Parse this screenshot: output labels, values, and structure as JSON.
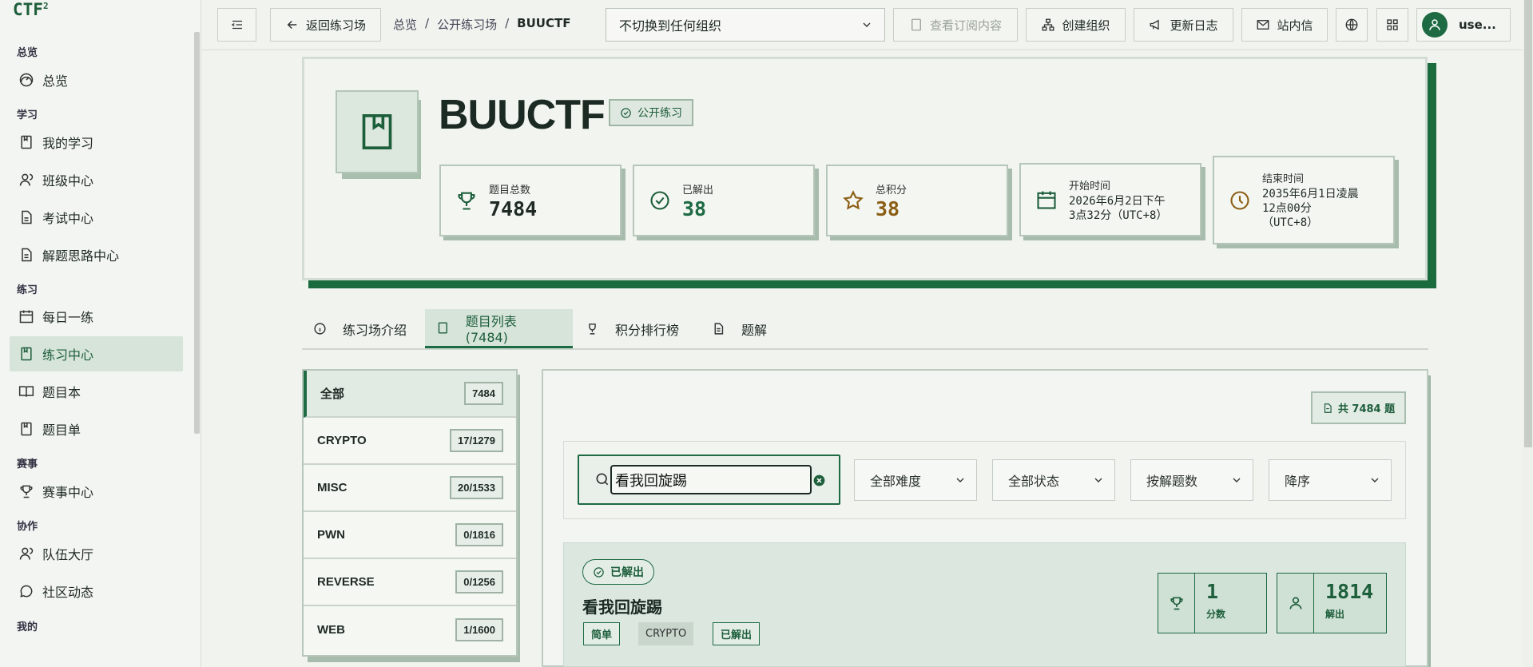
{
  "colors": {
    "accent": "#1d6a43",
    "gold": "#8b5e14",
    "active_bg": "#d6e4da"
  },
  "logo": {
    "text": "CTF",
    "sup": "2"
  },
  "sidebar": {
    "sections": [
      "总览",
      "学习",
      "练习",
      "赛事",
      "协作",
      "我的"
    ],
    "items": [
      {
        "label": "总览",
        "icon": "dashboard-icon"
      },
      {
        "label": "我的学习",
        "icon": "book-icon"
      },
      {
        "label": "班级中心",
        "icon": "users-icon"
      },
      {
        "label": "考试中心",
        "icon": "file-icon"
      },
      {
        "label": "解题思路中心",
        "icon": "file-text-icon"
      },
      {
        "label": "每日一练",
        "icon": "calendar-icon"
      },
      {
        "label": "练习中心",
        "icon": "book-icon",
        "active": true
      },
      {
        "label": "题目本",
        "icon": "open-book-icon"
      },
      {
        "label": "题目单",
        "icon": "book-icon"
      },
      {
        "label": "赛事中心",
        "icon": "trophy-icon"
      },
      {
        "label": "队伍大厅",
        "icon": "users-icon"
      },
      {
        "label": "社区动态",
        "icon": "chat-icon"
      }
    ]
  },
  "topbar": {
    "back_label": "返回练习场",
    "breadcrumb": [
      "总览",
      "公开练习场",
      "BUUCTF"
    ],
    "org_select": "不切换到任何组织",
    "view_subscription": "查看订阅内容",
    "create_org": "创建组织",
    "changelog": "更新日志",
    "messages": "站内信",
    "user": "use..."
  },
  "hero": {
    "title": "BUUCTF",
    "badge": "公开练习",
    "stats": [
      {
        "label": "题目总数",
        "value": "7484",
        "icon": "trophy-icon"
      },
      {
        "label": "已解出",
        "value": "38",
        "icon": "check-circle-icon"
      },
      {
        "label": "总积分",
        "value": "38",
        "icon": "star-icon"
      },
      {
        "label": "开始时间",
        "value": "2026年6月2日下午3点32分（UTC+8）",
        "lines": [
          "2026年6月2日下午",
          "3点32分（UTC+8）"
        ],
        "icon": "calendar-icon"
      },
      {
        "label": "结束时间",
        "value": "2035年6月1日凌晨12点00分（UTC+8）",
        "lines": [
          "2035年6月1日凌晨",
          "12点00分",
          "（UTC+8）"
        ],
        "icon": "clock-icon"
      }
    ]
  },
  "tabs": [
    {
      "label": "练习场介绍",
      "icon": "info-icon"
    },
    {
      "label": "题目列表 (7484)",
      "icon": "book-icon",
      "active": true
    },
    {
      "label": "积分排行榜",
      "icon": "trophy-icon"
    },
    {
      "label": "题解",
      "icon": "file-text-icon"
    }
  ],
  "categories": [
    {
      "name": "全部",
      "count": "7484",
      "active": true
    },
    {
      "name": "CRYPTO",
      "count": "17/1279"
    },
    {
      "name": "MISC",
      "count": "20/1533"
    },
    {
      "name": "PWN",
      "count": "0/1816"
    },
    {
      "name": "REVERSE",
      "count": "0/1256"
    },
    {
      "name": "WEB",
      "count": "1/1600"
    }
  ],
  "list": {
    "total_label": "共 7484 题",
    "search_value": "看我回旋踢",
    "filters": [
      "全部难度",
      "全部状态",
      "按解题数",
      "降序"
    ]
  },
  "challenge": {
    "status_chip": "已解出",
    "name": "看我回旋踢",
    "tags": [
      "简单",
      "CRYPTO",
      "已解出"
    ],
    "score_value": "1",
    "score_label": "分数",
    "solves_value": "1814",
    "solves_label": "解出"
  }
}
